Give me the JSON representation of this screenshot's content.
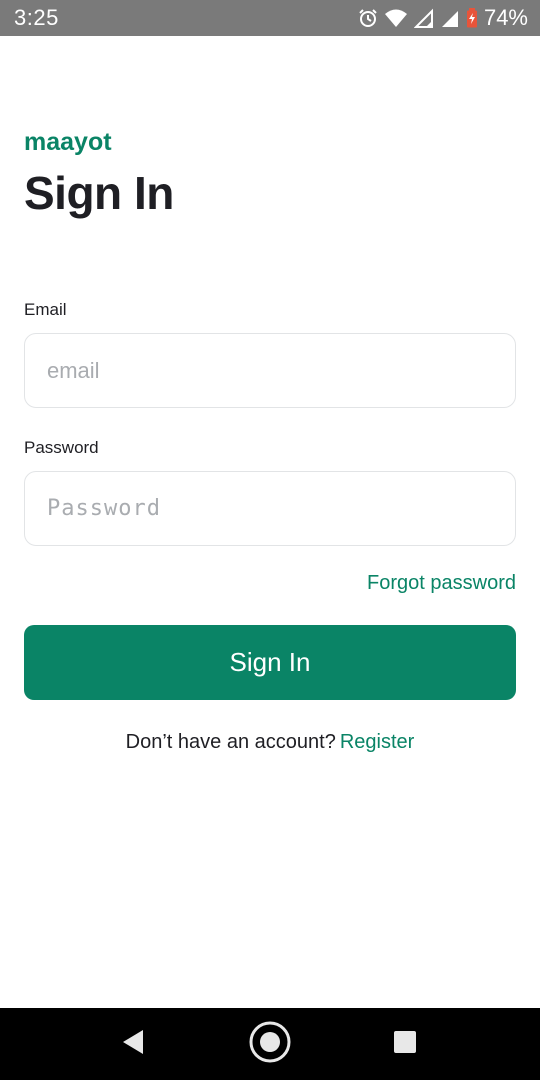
{
  "status_bar": {
    "time": "3:25",
    "battery_percent": "74%",
    "icons": [
      "alarm-icon",
      "wifi-icon",
      "signal-icon",
      "signal-icon",
      "battery-icon"
    ]
  },
  "brand": "maayot",
  "title": "Sign In",
  "form": {
    "email_label": "Email",
    "email_placeholder": "email",
    "password_label": "Password",
    "password_placeholder": "Password",
    "forgot_password": "Forgot password",
    "submit_label": "Sign In"
  },
  "register": {
    "prompt": "Don’t have an account?",
    "link": "Register"
  },
  "nav_bar": {
    "icons": [
      "back-icon",
      "home-icon",
      "recents-icon"
    ]
  },
  "colors": {
    "accent": "#0a8466",
    "text": "#1f1f24",
    "status_bar": "#7a7a7a",
    "nav_bar": "#000000"
  }
}
